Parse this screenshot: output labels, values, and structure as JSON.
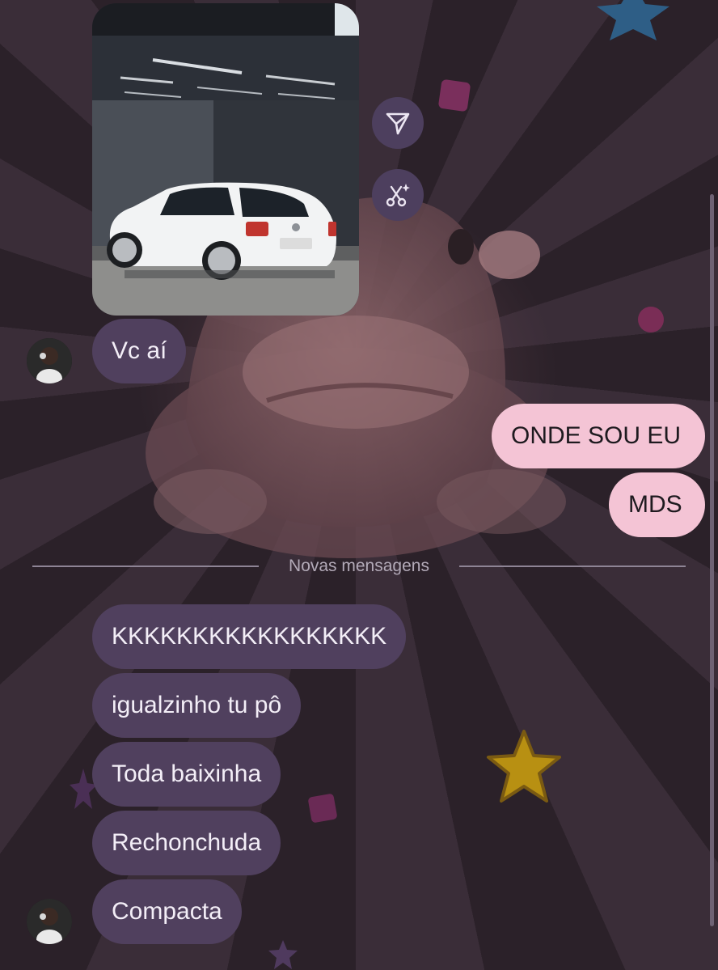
{
  "chat": {
    "messages": [
      {
        "from": "them",
        "type": "image",
        "alt": "white hatchback car parked in a garage"
      },
      {
        "from": "them",
        "text": "Vc aí"
      },
      {
        "from": "me",
        "text": "ONDE SOU EU"
      },
      {
        "from": "me",
        "text": "MDS"
      },
      {
        "from": "them",
        "text": "KKKKKKKKKKKKKKKKK"
      },
      {
        "from": "them",
        "text": "igualzinho tu pô"
      },
      {
        "from": "them",
        "text": "Toda baixinha"
      },
      {
        "from": "them",
        "text": "Rechonchuda"
      },
      {
        "from": "them",
        "text": "Compacta"
      }
    ],
    "new_messages_label": "Novas mensagens",
    "actions": {
      "share_icon": "send-icon",
      "remix_icon": "scissors-sparkle-icon"
    },
    "theme": {
      "incoming_bubble": "#50405e",
      "outgoing_bubble": "#f4c4d5",
      "background": "#2f2530"
    }
  }
}
